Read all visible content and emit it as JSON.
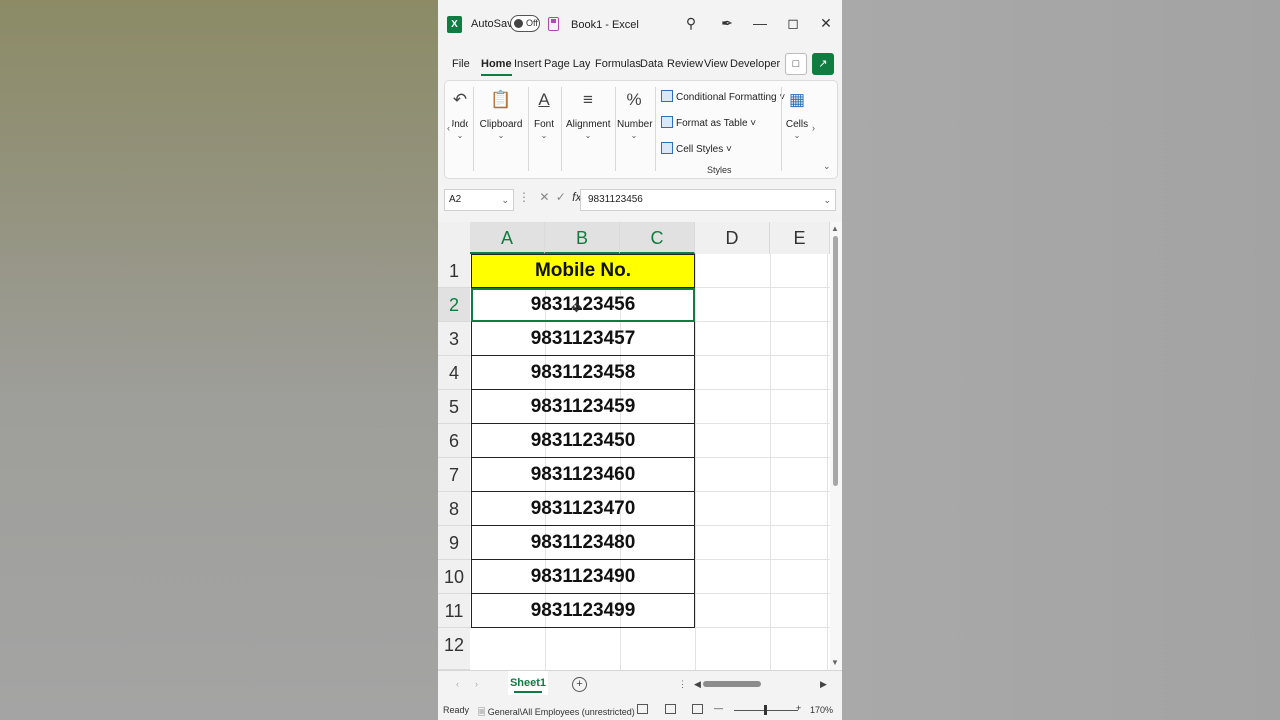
{
  "titlebar": {
    "app_icon": "excel-icon",
    "autosave_label": "AutoSave",
    "autosave_state": "Off",
    "doc_title": "Book1 - Excel",
    "icons": [
      "search-icon",
      "pen-icon",
      "minimize-icon",
      "maximize-icon",
      "close-icon"
    ]
  },
  "tabs": [
    "File",
    "Home",
    "Insert",
    "Page Layou",
    "Formulas",
    "Data",
    "Review",
    "View",
    "Developer"
  ],
  "active_tab": "Home",
  "ribbon": {
    "undo": "Undo",
    "clipboard": "Clipboard",
    "font": "Font",
    "alignment": "Alignment",
    "number": "Number",
    "conditional_formatting": "Conditional Formatting",
    "format_as_table": "Format as Table",
    "cell_styles": "Cell Styles",
    "styles_group": "Styles",
    "cells": "Cells",
    "number_symbol": "%"
  },
  "formula_bar": {
    "name_box": "A2",
    "fx": "fx",
    "value": "9831123456"
  },
  "grid": {
    "columns": [
      "A",
      "B",
      "C",
      "D",
      "E"
    ],
    "rows": [
      "1",
      "2",
      "3",
      "4",
      "5",
      "6",
      "7",
      "8",
      "9",
      "10",
      "11",
      "12"
    ],
    "header_cell": "Mobile No.",
    "values": [
      "9831123456",
      "9831123457",
      "9831123458",
      "9831123459",
      "9831123450",
      "9831123460",
      "9831123470",
      "9831123480",
      "9831123490",
      "9831123499"
    ],
    "active_cell": "A2",
    "header_fill": "#ffff00"
  },
  "sheets": [
    "Sheet1"
  ],
  "statusbar": {
    "ready": "Ready",
    "sensitivity": "General\\All Employees (unrestricted)",
    "zoom": "170%"
  },
  "colors": {
    "accent": "#107c41"
  }
}
